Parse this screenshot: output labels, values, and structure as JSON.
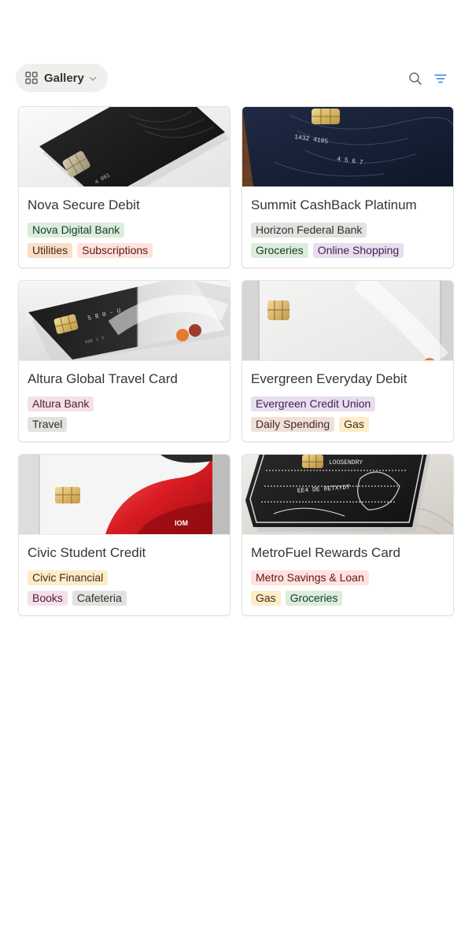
{
  "toolbar": {
    "view_label": "Gallery",
    "view_icon": "grid-icon",
    "search_icon": "search-icon",
    "filter_icon": "filter-icon"
  },
  "cards": [
    {
      "title": "Nova Secure Debit",
      "bank": {
        "label": "Nova Digital Bank",
        "color": "green"
      },
      "categories": [
        {
          "label": "Utilities",
          "color": "orange"
        },
        {
          "label": "Subscriptions",
          "color": "red"
        }
      ],
      "cover_theme": "black-card-on-white"
    },
    {
      "title": "Summit CashBack Platinum",
      "bank": {
        "label": "Horizon Federal Bank",
        "color": "gray"
      },
      "categories": [
        {
          "label": "Groceries",
          "color": "green"
        },
        {
          "label": "Online Shopping",
          "color": "purple"
        }
      ],
      "cover_theme": "navy-card-on-wood"
    },
    {
      "title": "Altura Global Travel Card",
      "bank": {
        "label": "Altura Bank",
        "color": "pink"
      },
      "categories": [
        {
          "label": "Travel",
          "color": "gray"
        }
      ],
      "cover_theme": "black-silver-card"
    },
    {
      "title": "Evergreen Everyday Debit",
      "bank": {
        "label": "Evergreen Credit Union",
        "color": "purple"
      },
      "categories": [
        {
          "label": "Daily Spending",
          "color": "brown"
        },
        {
          "label": "Gas",
          "color": "yellow"
        }
      ],
      "cover_theme": "white-card"
    },
    {
      "title": "Civic Student Credit",
      "bank": {
        "label": "Civic Financial",
        "color": "yellow"
      },
      "categories": [
        {
          "label": "Books",
          "color": "pink"
        },
        {
          "label": "Cafeteria",
          "color": "gray"
        }
      ],
      "cover_theme": "red-white-card"
    },
    {
      "title": "MetroFuel Rewards Card",
      "bank": {
        "label": "Metro Savings & Loan",
        "color": "red"
      },
      "categories": [
        {
          "label": "Gas",
          "color": "yellow"
        },
        {
          "label": "Groceries",
          "color": "green"
        }
      ],
      "cover_theme": "black-silver-ornate-card-on-marble"
    }
  ]
}
